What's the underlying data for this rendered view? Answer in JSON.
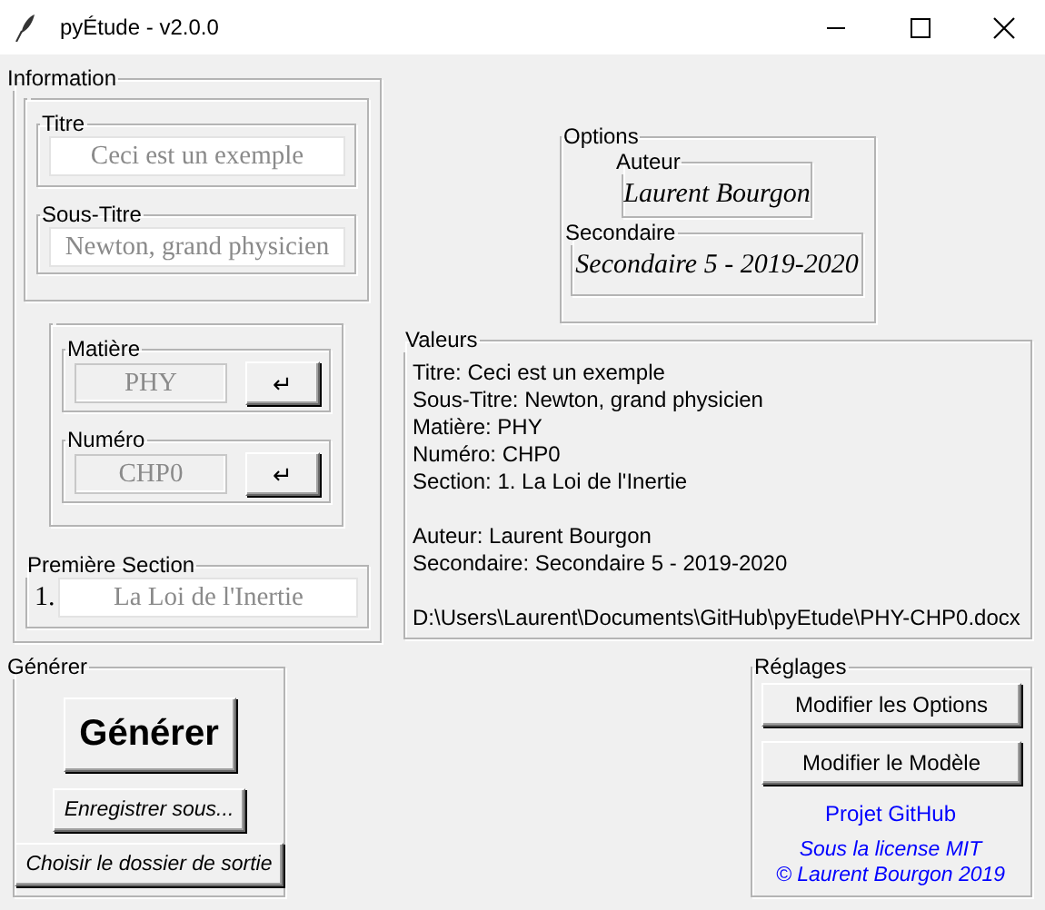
{
  "window": {
    "title": "pyÉtude - v2.0.0"
  },
  "information": {
    "label": "Information",
    "titre": {
      "label": "Titre",
      "value": "Ceci est un exemple",
      "disabled": false
    },
    "sous_titre": {
      "label": "Sous-Titre",
      "value": "Newton, grand physicien",
      "disabled": false
    },
    "matiere": {
      "label": "Matière",
      "value": "PHY",
      "disabled": true,
      "button": "↵"
    },
    "numero": {
      "label": "Numéro",
      "value": "CHP0",
      "disabled": true,
      "button": "↵"
    },
    "premiere_section": {
      "label": "Première Section",
      "number": "1.",
      "value": "La Loi de l'Inertie",
      "disabled": false
    }
  },
  "options": {
    "label": "Options",
    "auteur": {
      "label": "Auteur",
      "value": "Laurent Bourgon"
    },
    "secondaire": {
      "label": "Secondaire",
      "value": "Secondaire 5 - 2019-2020"
    }
  },
  "valeurs": {
    "label": "Valeurs",
    "paragraphs": [
      [
        "Titre: Ceci est un exemple",
        "Sous-Titre: Newton, grand physicien",
        "Matière: PHY",
        "Numéro: CHP0",
        "Section: 1. La Loi de l'Inertie"
      ],
      [
        "Auteur: Laurent Bourgon",
        "Secondaire: Secondaire 5 - 2019-2020"
      ],
      [
        "D:\\Users\\Laurent\\Documents\\GitHub\\pyEtude\\PHY-CHP0.docx"
      ]
    ]
  },
  "generer": {
    "label": "Générer",
    "buttons": [
      {
        "label": "Générer",
        "kind": "primary"
      },
      {
        "label": "Enregistrer sous...",
        "kind": "secondary"
      },
      {
        "label": "Choisir le dossier de sortie",
        "kind": "secondary"
      }
    ]
  },
  "reglages": {
    "label": "Réglages",
    "buttons": [
      "Modifier les Options",
      "Modifier le Modèle"
    ],
    "link": "Projet GitHub",
    "license": [
      "Sous la license MIT",
      "© Laurent Bourgon 2019"
    ]
  }
}
